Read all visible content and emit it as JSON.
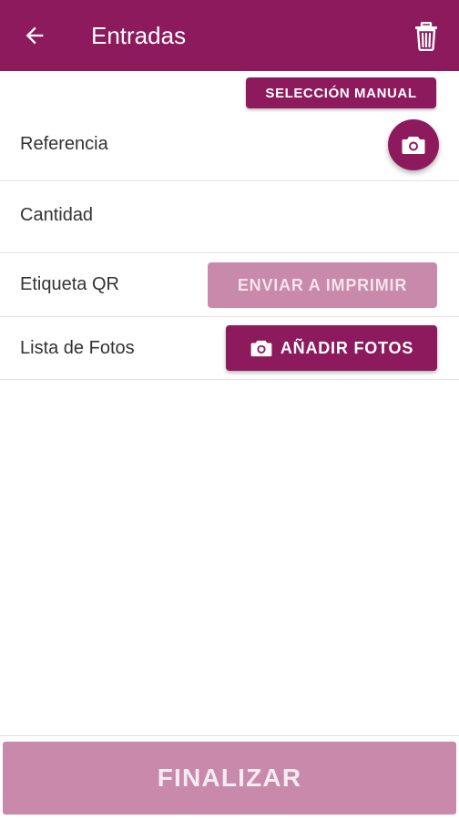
{
  "appbar": {
    "title": "Entradas",
    "back_icon": "arrow-left-icon",
    "trash_icon": "trash-icon",
    "color": "#8e1a5e"
  },
  "manual_selection": {
    "label": "SELECCIÓN MANUAL"
  },
  "fields": {
    "referencia": {
      "label": "Referencia",
      "action_icon": "camera-icon"
    },
    "cantidad": {
      "label": "Cantidad"
    },
    "etiqueta_qr": {
      "label": "Etiqueta QR",
      "button_label": "ENVIAR A IMPRIMIR"
    },
    "lista_fotos": {
      "label": "Lista de Fotos",
      "button_label": "AÑADIR FOTOS",
      "button_icon": "camera-icon"
    }
  },
  "footer": {
    "finalize_label": "FINALIZAR",
    "disabled_color": "#c989ab"
  }
}
